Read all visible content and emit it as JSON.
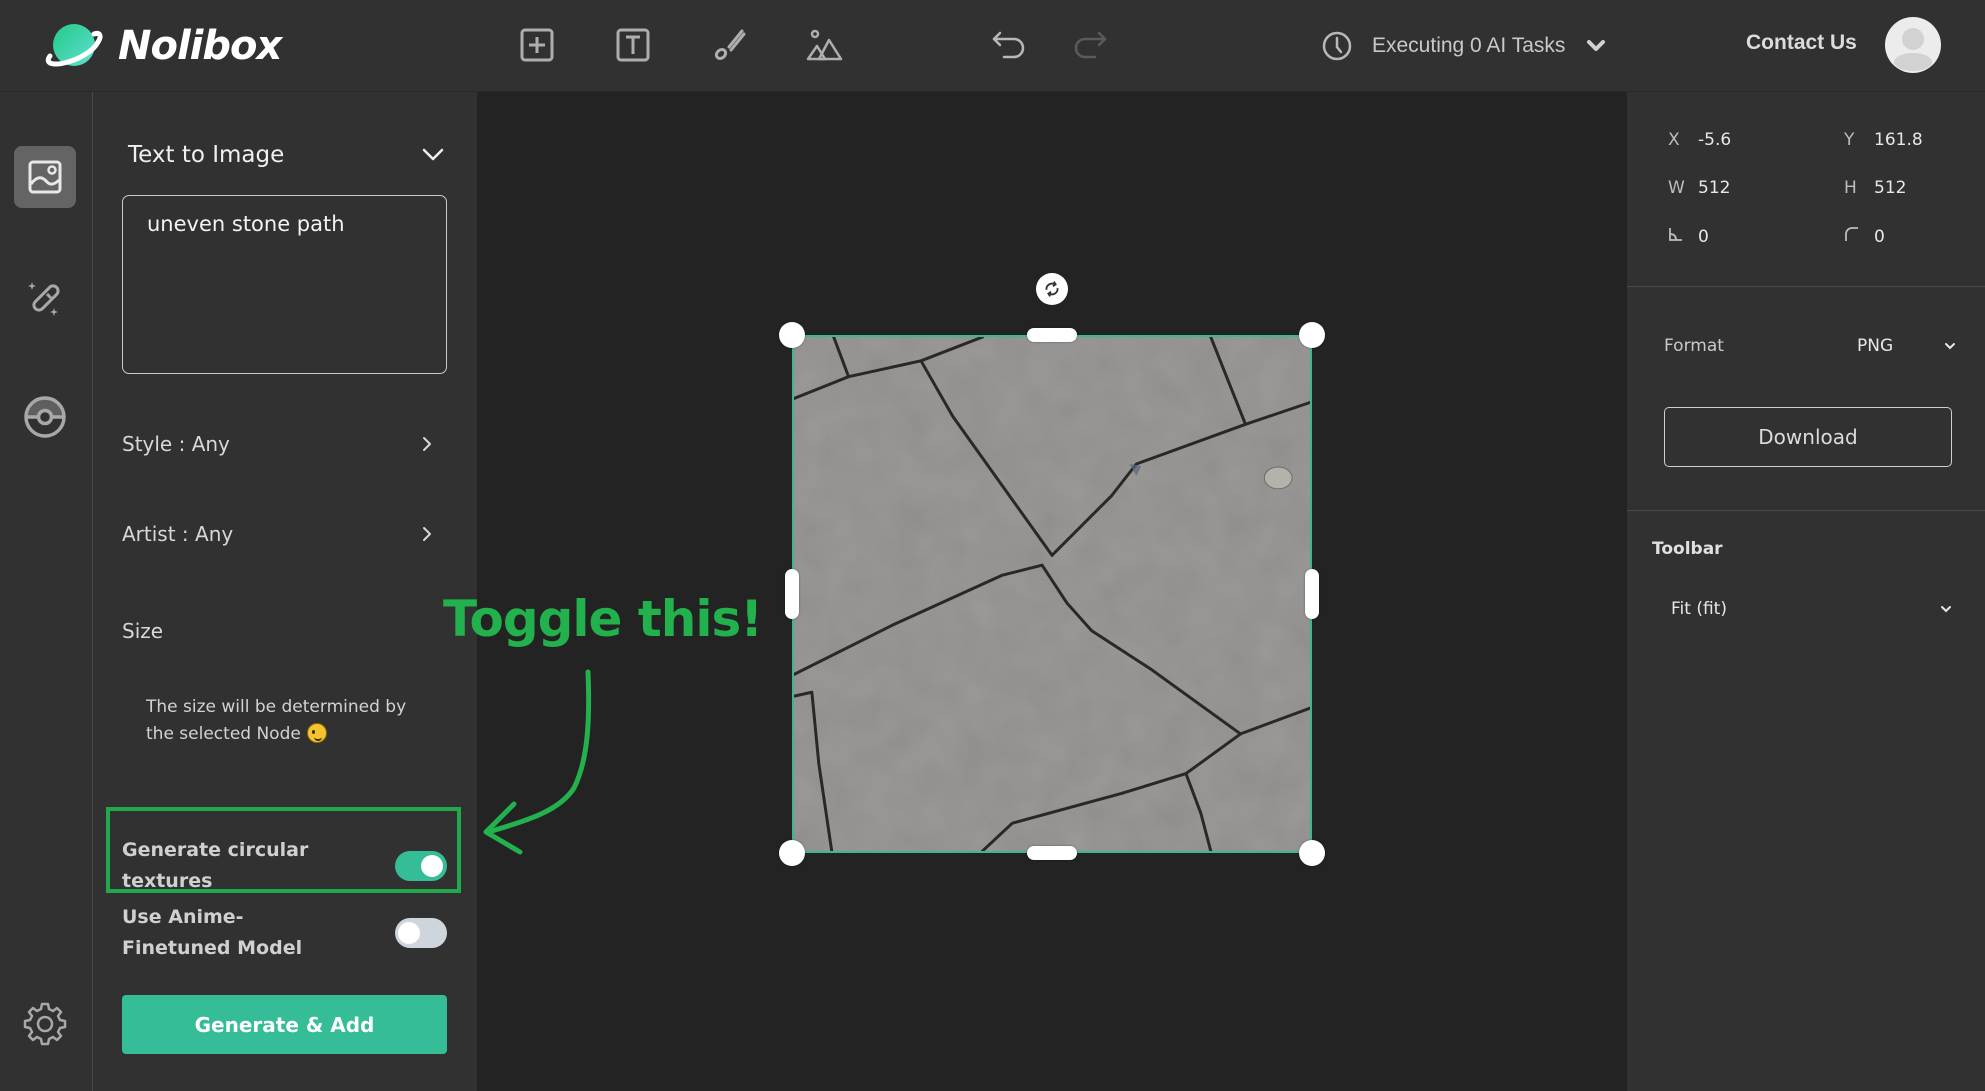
{
  "header": {
    "brand": "Nolibox",
    "tools": [
      {
        "name": "add-node",
        "icon": "plus-square-icon"
      },
      {
        "name": "add-text",
        "icon": "text-square-icon"
      },
      {
        "name": "brush",
        "icon": "brush-icon"
      },
      {
        "name": "add-image",
        "icon": "mountain-image-icon"
      }
    ],
    "undo_icon": "undo-icon",
    "redo_icon": "redo-icon",
    "tasks_label": "Executing 0 AI Tasks",
    "contact_label": "Contact Us"
  },
  "sidebar": {
    "items": [
      {
        "name": "text-to-image",
        "icon": "image-icon",
        "active": true
      },
      {
        "name": "magic-wand",
        "icon": "magic-wand-icon",
        "active": false
      },
      {
        "name": "pokeball",
        "icon": "pokeball-icon",
        "active": false
      }
    ],
    "settings_icon": "gear-icon"
  },
  "panel": {
    "title": "Text to Image",
    "prompt_value": "uneven stone path",
    "style_label": "Style : Any",
    "artist_label": "Artist : Any",
    "size_title": "Size",
    "size_note": "The size will be determined by the selected Node",
    "toggles": [
      {
        "label": "Generate circular textures",
        "on": true
      },
      {
        "label": "Use Anime-Finetuned Model",
        "on": false
      }
    ],
    "generate_label": "Generate & Add"
  },
  "canvas": {
    "annotation_text": "Toggle this!",
    "annotation_color": "#22b14c",
    "node_content": "stone texture image"
  },
  "properties": {
    "x": {
      "label": "X",
      "value": "-5.6"
    },
    "y": {
      "label": "Y",
      "value": "161.8"
    },
    "w": {
      "label": "W",
      "value": "512"
    },
    "h": {
      "label": "H",
      "value": "512"
    },
    "skew": {
      "icon": "skew-angle-icon",
      "value": "0"
    },
    "radius": {
      "icon": "corner-radius-icon",
      "value": "0"
    }
  },
  "export": {
    "format_label": "Format",
    "format_value": "PNG",
    "download_label": "Download"
  },
  "toolbar": {
    "heading": "Toolbar",
    "fit_value": "Fit (fit)"
  },
  "colors": {
    "accent": "#35bd98",
    "annotation": "#22b14c",
    "header_bg": "#313131",
    "canvas_bg": "#232323"
  }
}
